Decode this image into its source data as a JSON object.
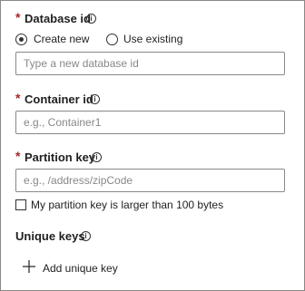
{
  "database": {
    "label": "Database id",
    "required_marker": "*",
    "info_icon": "info-icon",
    "radio_create": "Create new",
    "radio_existing": "Use existing",
    "selected": "Create new",
    "input_placeholder": "Type a new database id",
    "input_value": ""
  },
  "container": {
    "label": "Container id",
    "required_marker": "*",
    "info_icon": "info-icon",
    "input_placeholder": "e.g., Container1",
    "input_value": ""
  },
  "partition": {
    "label": "Partition key",
    "required_marker": "*",
    "info_icon": "info-icon",
    "input_placeholder": "e.g., /address/zipCode",
    "input_value": "",
    "large_key_checkbox_label": "My partition key is larger than 100 bytes",
    "large_key_checked": false
  },
  "unique_keys": {
    "label": "Unique keys",
    "info_icon": "info-icon",
    "add_icon": "plus-icon",
    "add_button_label": "Add unique key"
  },
  "colors": {
    "required": "#a4262c",
    "text": "#201f1e",
    "border": "#8a8886",
    "placeholder": "#8a8886"
  }
}
